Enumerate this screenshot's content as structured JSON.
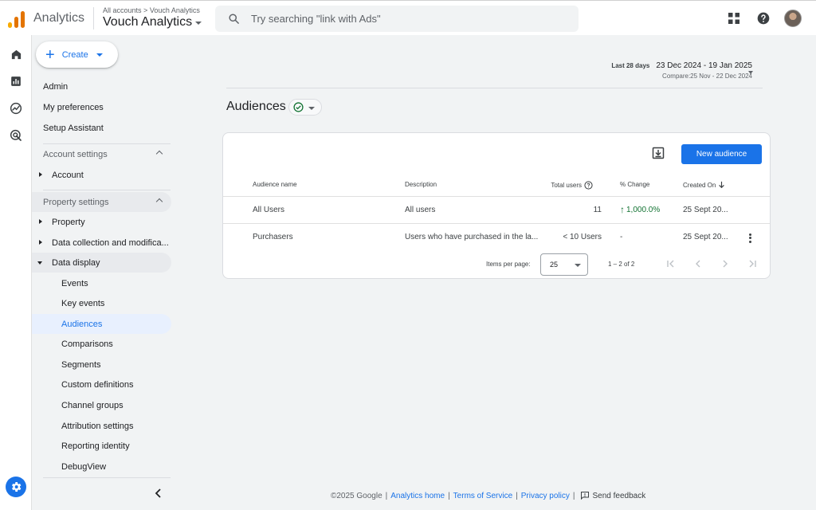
{
  "header": {
    "app_name": "Analytics",
    "breadcrumb": {
      "accounts": "All accounts",
      "separator": ">",
      "account": "Vouch Analytics"
    },
    "property": "Vouch Analytics",
    "search_placeholder": "Try searching \"link with Ads\"",
    "icons": [
      "apps-grid-icon",
      "help-icon",
      "avatar"
    ]
  },
  "rail": {
    "items": [
      "home-icon",
      "reports-icon",
      "explore-icon",
      "advertising-icon"
    ],
    "admin": "gear-icon"
  },
  "nav": {
    "create_label": "Create",
    "admin": "Admin",
    "my_preferences": "My preferences",
    "setup_assistant": "Setup Assistant",
    "account_settings": "Account settings",
    "account": "Account",
    "property_settings": "Property settings",
    "property": "Property",
    "data_collection": "Data collection and modifica...",
    "data_display": "Data display",
    "sub_items": [
      "Events",
      "Key events",
      "Audiences",
      "Comparisons",
      "Segments",
      "Custom definitions",
      "Channel groups",
      "Attribution settings",
      "Reporting identity",
      "DebugView"
    ],
    "active_item": "Audiences"
  },
  "date": {
    "chip": "Last 28 days",
    "range": "23 Dec 2024 - 19 Jan 2025",
    "compare": "Compare:25 Nov - 22 Dec 2024"
  },
  "page": {
    "title": "Audiences",
    "new_audience_label": "New audience"
  },
  "table": {
    "columns": {
      "name": "Audience name",
      "description": "Description",
      "total_users": "Total users",
      "change": "% Change",
      "created": "Created On"
    },
    "rows": [
      {
        "name": "All Users",
        "description": "All users",
        "total_users": "11",
        "change": "1,000.0%",
        "change_arrow": "↑",
        "created": "25 Sept 20..."
      },
      {
        "name": "Purchasers",
        "description": "Users who have purchased in the la...",
        "total_users": "< 10 Users",
        "change": "-",
        "change_arrow": "",
        "created": "25 Sept 20..."
      }
    ],
    "pager": {
      "items_per_page_label": "Items per page:",
      "items_per_page": "25",
      "range": "1 – 2 of 2"
    }
  },
  "footer": {
    "copyright": "©2025 Google",
    "links": [
      "Analytics home",
      "Terms of Service",
      "Privacy policy"
    ],
    "separator": "|",
    "feedback": "Send feedback"
  },
  "colors": {
    "accent": "#1a73e8",
    "positive": "#137333",
    "logo": [
      "#f9ab00",
      "#e37400",
      "#e37400"
    ]
  }
}
